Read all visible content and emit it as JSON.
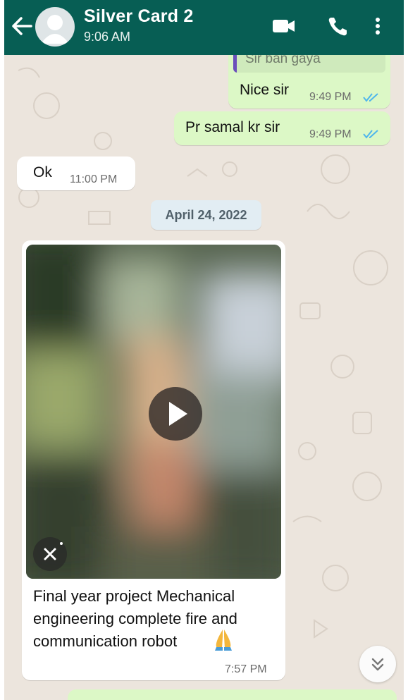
{
  "header": {
    "contact_name": "Silver Card 2",
    "status": "9:06 AM",
    "back_icon": "arrow-left-icon",
    "video_icon": "video-call-icon",
    "call_icon": "phone-icon",
    "menu_icon": "more-vertical-icon",
    "color": "#075e54"
  },
  "messages": [
    {
      "direction": "out",
      "quoted": "Sir ban gaya",
      "text": "Nice sir",
      "time": "9:49 PM",
      "status": "read"
    },
    {
      "direction": "out",
      "text": "Pr samal kr sir",
      "time": "9:49 PM",
      "status": "read"
    },
    {
      "direction": "in",
      "text": "Ok",
      "time": "11:00 PM"
    }
  ],
  "date_separator": "April 24, 2022",
  "media_message": {
    "direction": "in",
    "type": "video",
    "caption": "Final year project Mechanical engineering complete fire and communication robot",
    "emoji": "🙏",
    "time": "7:57 PM",
    "play_icon": "play-icon",
    "cancel_icon": "close-icon"
  },
  "scroll_down_icon": "double-chevron-down-icon",
  "colors": {
    "outgoing_bubble": "#dcf8c6",
    "incoming_bubble": "#ffffff",
    "read_ticks": "#4fb6ec",
    "wallpaper": "#ece5dd"
  }
}
